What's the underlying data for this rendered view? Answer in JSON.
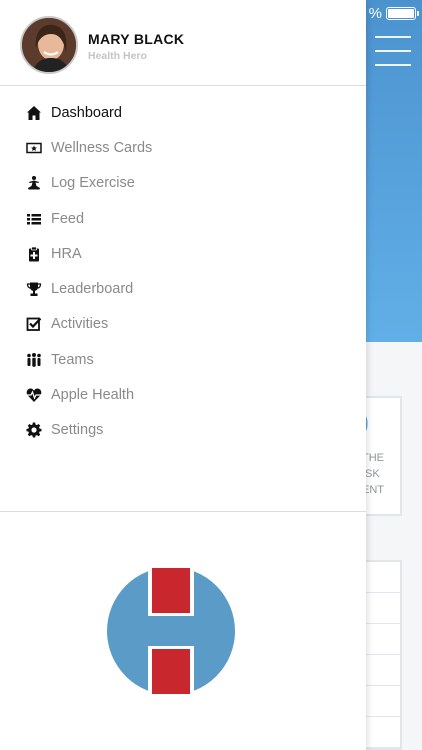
{
  "status_bar": {
    "battery_text": "%"
  },
  "drawer": {
    "user": {
      "name": "MARY BLACK",
      "role": "Health Hero"
    },
    "menu": [
      {
        "label": "Dashboard",
        "icon": "home-icon",
        "active": true
      },
      {
        "label": "Wellness Cards",
        "icon": "card-icon",
        "active": false
      },
      {
        "label": "Log Exercise",
        "icon": "exercise-icon",
        "active": false
      },
      {
        "label": "Feed",
        "icon": "list-icon",
        "active": false
      },
      {
        "label": "HRA",
        "icon": "clipboard-icon",
        "active": false
      },
      {
        "label": "Leaderboard",
        "icon": "trophy-icon",
        "active": false
      },
      {
        "label": "Activities",
        "icon": "checkbox-icon",
        "active": false
      },
      {
        "label": "Teams",
        "icon": "people-icon",
        "active": false
      },
      {
        "label": "Apple Health",
        "icon": "heart-pulse-icon",
        "active": false
      },
      {
        "label": "Settings",
        "icon": "gear-icon",
        "active": false
      }
    ]
  },
  "background_page": {
    "card_number_fragment": "0",
    "card_text_fragment": "THE\nISK\nENT"
  },
  "colors": {
    "header_blue": "#4b93cf",
    "logo_blue": "#5b9bc8",
    "logo_red": "#c8272d"
  }
}
